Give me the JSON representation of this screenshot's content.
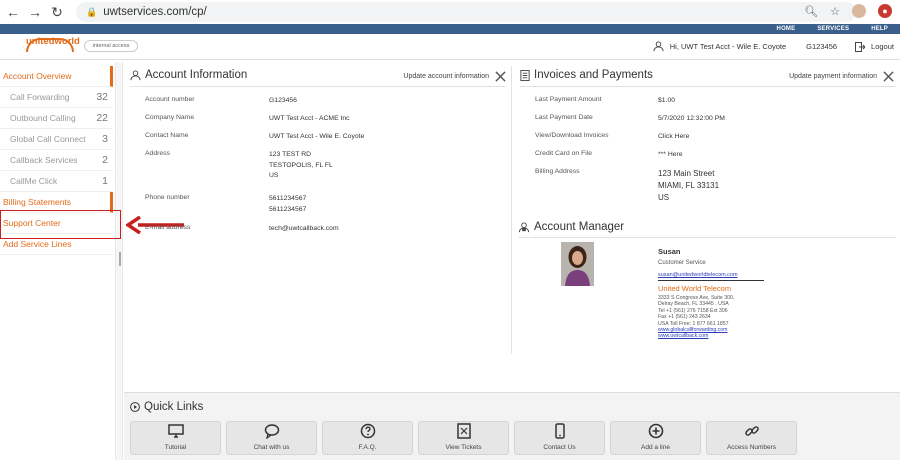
{
  "browser": {
    "url": "uwtservices.com/cp/"
  },
  "topnav": [
    "HOME",
    "SERVICES",
    "HELP"
  ],
  "header": {
    "logo_text": "unitedworld",
    "internal_access": "internal access",
    "greeting": "Hi, UWT Test Acct - Wile E. Coyote",
    "account_id": "G123456",
    "logout": "Logout"
  },
  "sidebar": {
    "items": [
      {
        "label": "Account Overview",
        "count": "",
        "style": "orange active"
      },
      {
        "label": "Call Forwarding",
        "count": "32",
        "style": "sub"
      },
      {
        "label": "Outbound Calling",
        "count": "22",
        "style": "sub"
      },
      {
        "label": "Global Call Connect",
        "count": "3",
        "style": "sub"
      },
      {
        "label": "Callback Services",
        "count": "2",
        "style": "sub"
      },
      {
        "label": "CallMe Click",
        "count": "1",
        "style": "sub"
      },
      {
        "label": "Billing Statements",
        "count": "",
        "style": "orange active"
      },
      {
        "label": "Support Center",
        "count": "",
        "style": "orange"
      },
      {
        "label": "Add Service Lines",
        "count": "",
        "style": "orange"
      }
    ]
  },
  "account_info": {
    "title": "Account Information",
    "update_link": "Update account information",
    "rows": [
      {
        "label": "Account number",
        "value": "G123456"
      },
      {
        "label": "Company Name",
        "value": "UWT Test Acct - ACME Inc"
      },
      {
        "label": "Contact Name",
        "value": "UWT Test Acct - Wile E. Coyote"
      },
      {
        "label": "Address",
        "value": "123 TEST RD\nTESTOPOLIS, FL FL\nUS"
      },
      {
        "label": "Phone number",
        "value": "5611234567\n5611234567"
      },
      {
        "label": "E-mail address",
        "value": "tech@uwtcallback.com"
      }
    ]
  },
  "invoices": {
    "title": "Invoices and Payments",
    "update_link": "Update payment information",
    "rows": [
      {
        "label": "Last Payment Amount",
        "value": "$1.00"
      },
      {
        "label": "Last Payment Date",
        "value": "5/7/2020 12:32:00 PM"
      },
      {
        "label": "View/Download Invoices",
        "value": "Click Here"
      },
      {
        "label": "Credit Card on File",
        "value": "*** Here"
      },
      {
        "label": "Billing Address",
        "value": "123 Main Street\nMIAMI, FL 33131\nUS"
      }
    ]
  },
  "account_manager": {
    "title": "Account Manager",
    "name": "Susan",
    "role": "Customer Service",
    "email": "susan@unitedworldtelecom.com",
    "company": "United World Telecom",
    "address1": "3333 S Congress Ave, Suite 300,",
    "address2": "Delray Beach, FL 33445 . USA",
    "tel": "Tel +1 (561) 276 7158 Ext 306",
    "fax": "Fax +1 (561) 243 2634",
    "tollfree": "USA Toll Free: 1 877 661 1857",
    "link1": "www.globalcallforwarding.com",
    "link2": "www.uwtcallback.com"
  },
  "quick_links": {
    "title": "Quick Links",
    "buttons": [
      {
        "label": "Tutorial",
        "icon": "monitor-icon"
      },
      {
        "label": "Chat with us",
        "icon": "chat-icon"
      },
      {
        "label": "F.A.Q.",
        "icon": "question-icon"
      },
      {
        "label": "View Tickets",
        "icon": "ticket-icon"
      },
      {
        "label": "Contact Us",
        "icon": "phone-icon"
      },
      {
        "label": "Add a line",
        "icon": "plus-circle-icon"
      },
      {
        "label": "Access Numbers",
        "icon": "link-icon"
      }
    ]
  },
  "colors": {
    "accent": "#e36b1a",
    "nav": "#3a5f8a",
    "annotation": "#c81e1e"
  }
}
